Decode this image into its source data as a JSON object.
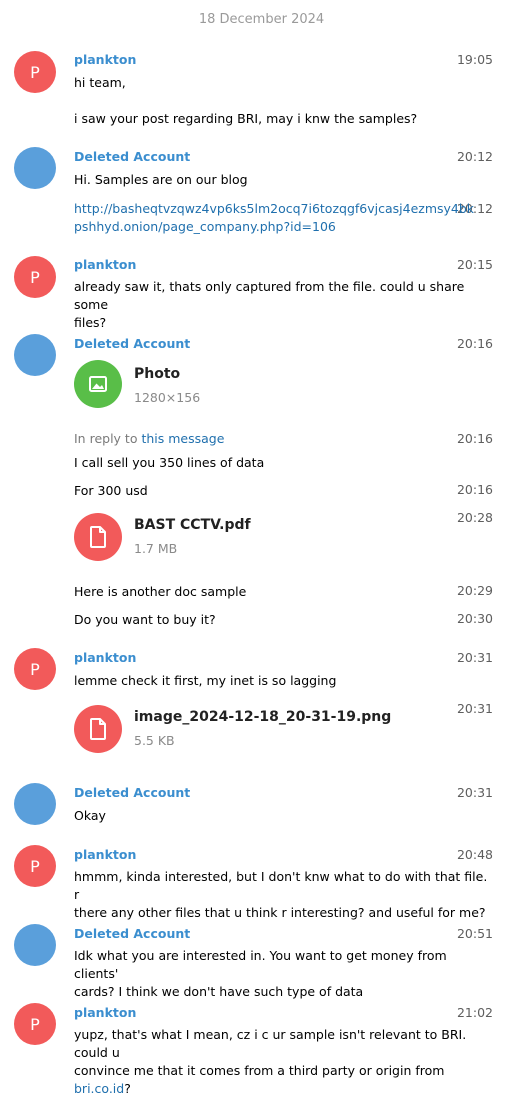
{
  "date_divider": "18 December 2024",
  "messages": [
    {
      "sender": "plankton",
      "avatar_letter": "P",
      "time": "19:05",
      "text": "hi team,"
    },
    {
      "text": "i saw your post regarding BRI, may i knw the samples?"
    },
    {
      "sender": "Deleted Account",
      "time": "20:12",
      "text": "Hi. Samples are on our blog"
    },
    {
      "time": "20:12",
      "link_line1": "http://basheqtvzqwz4vp6ks5lm2ocq7i6tozqgf6vjcasj4ezmsy4bk",
      "link_line2": "pshhyd.onion/page_company.php?id=106"
    },
    {
      "sender": "plankton",
      "avatar_letter": "P",
      "time": "20:15",
      "text_line1": "already saw it, thats only captured from the file. could u share some",
      "text_line2": "files?"
    },
    {
      "sender": "Deleted Account",
      "time": "20:16",
      "file_title": "Photo",
      "file_sub": "1280×156"
    },
    {
      "time": "20:16",
      "reply_prefix": "In reply to",
      "reply_link": "this message",
      "text": "I call sell you 350 lines of data"
    },
    {
      "time": "20:16",
      "text": "For 300 usd"
    },
    {
      "time": "20:28",
      "file_title": "BAST CCTV.pdf",
      "file_sub": "1.7 MB"
    },
    {
      "time": "20:29",
      "text": "Here is another doc sample"
    },
    {
      "time": "20:30",
      "text": "Do you want to buy it?"
    },
    {
      "sender": "plankton",
      "avatar_letter": "P",
      "time": "20:31",
      "text": "lemme check it first, my inet is so lagging"
    },
    {
      "time": "20:31",
      "file_title": "image_2024-12-18_20-31-19.png",
      "file_sub": "5.5 KB"
    },
    {
      "sender": "Deleted Account",
      "time": "20:31",
      "text": "Okay"
    },
    {
      "sender": "plankton",
      "avatar_letter": "P",
      "time": "20:48",
      "text_line1": "hmmm, kinda interested, but I don't knw what to do with that file. r",
      "text_line2": "there any other files that u think r interesting? and useful for me?"
    },
    {
      "sender": "Deleted Account",
      "time": "20:51",
      "text_line1": "Idk what you are interested in. You want to get money from clients'",
      "text_line2": "cards? I think we don't have such type of data"
    },
    {
      "sender": "plankton",
      "avatar_letter": "P",
      "time": "21:02",
      "text_line1": "yupz, that's what I mean, cz i c ur sample isn't relevant to BRI. could u",
      "text_line2_prefix": "convince me that it comes from a third party or origin from ",
      "text_line2_link": "bri.co.id",
      "text_line2_suffix": "?"
    }
  ],
  "colors": {
    "accent_name": "#3b8ecf",
    "avatar_red": "#f25a5a",
    "avatar_blue": "#5a9fdb",
    "photo_icon_green": "#59be48",
    "link": "#1f6fad"
  },
  "icons": {
    "photo": "image-icon",
    "file": "document-icon"
  }
}
